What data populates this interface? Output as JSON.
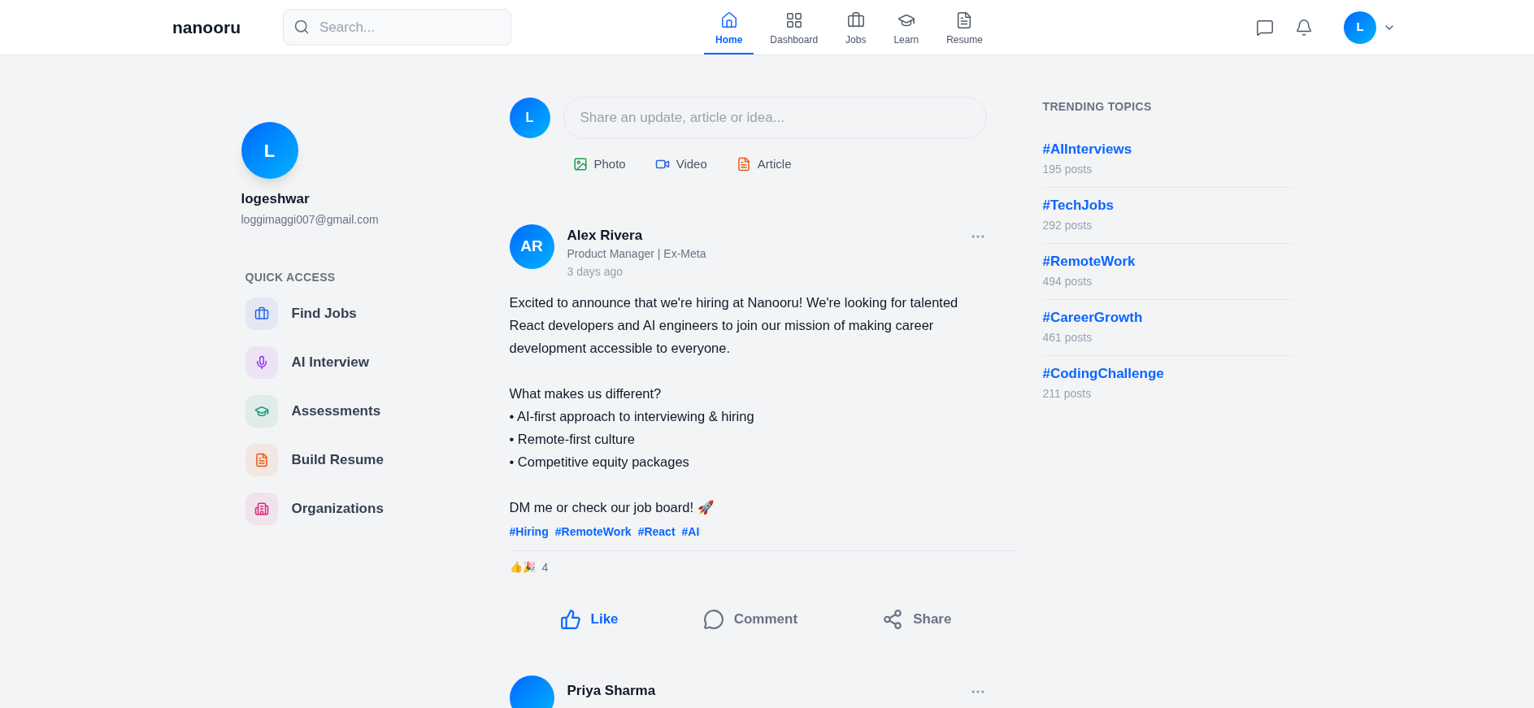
{
  "header": {
    "logo": "nanooru",
    "search": {
      "placeholder": "Search..."
    },
    "nav": [
      {
        "label": "Home",
        "selected": true
      },
      {
        "label": "Dashboard",
        "selected": false
      },
      {
        "label": "Jobs",
        "selected": false
      },
      {
        "label": "Learn",
        "selected": false
      },
      {
        "label": "Resume",
        "selected": false
      }
    ],
    "user_initial": "L"
  },
  "profile": {
    "initial": "L",
    "name": "logeshwar",
    "email": "loggimaggi007@gmail.com"
  },
  "quick_access": {
    "title": "QUICK ACCESS",
    "items": [
      {
        "label": "Find Jobs",
        "color": "#2563eb"
      },
      {
        "label": "AI Interview",
        "color": "#9333ea"
      },
      {
        "label": "Assessments",
        "color": "#059669"
      },
      {
        "label": "Build Resume",
        "color": "#ea580c"
      },
      {
        "label": "Organizations",
        "color": "#db2777"
      }
    ]
  },
  "composer": {
    "initial": "L",
    "placeholder": "Share an update, article or idea...",
    "actions": [
      {
        "label": "Photo",
        "color": "#16a34a"
      },
      {
        "label": "Video",
        "color": "#2563eb"
      },
      {
        "label": "Article",
        "color": "#ea580c"
      }
    ]
  },
  "posts": [
    {
      "initials": "AR",
      "author": "Alex Rivera",
      "headline": "Product Manager | Ex-Meta",
      "time": "3 days ago",
      "body": [
        "Excited to announce that we're hiring at Nanooru! We're looking for talented React developers and AI engineers to join our mission of making career development accessible to everyone.",
        "What makes us different?\n• AI-first approach to interviewing & hiring\n• Remote-first culture\n• Competitive equity packages",
        "DM me or check our job board! 🚀"
      ],
      "tags": [
        "#Hiring",
        "#RemoteWork",
        "#React",
        "#AI"
      ],
      "reactions": "👍🎉",
      "reaction_count": "4",
      "liked": true,
      "actions": [
        "Like",
        "Comment",
        "Share"
      ]
    },
    {
      "author": "Priya Sharma"
    }
  ],
  "trending": {
    "title": "TRENDING TOPICS",
    "topics": [
      {
        "tag": "#AIInterviews",
        "count": "195 posts"
      },
      {
        "tag": "#TechJobs",
        "count": "292 posts"
      },
      {
        "tag": "#RemoteWork",
        "count": "494 posts"
      },
      {
        "tag": "#CareerGrowth",
        "count": "461 posts"
      },
      {
        "tag": "#CodingChallenge",
        "count": "211 posts"
      }
    ]
  }
}
